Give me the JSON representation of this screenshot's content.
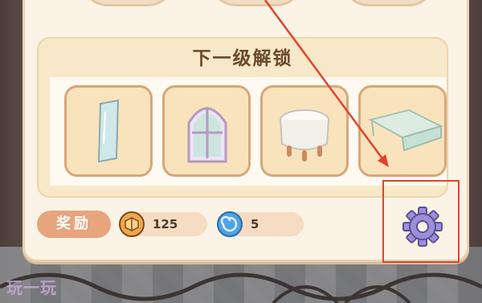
{
  "panel": {
    "unlock_title": "下一级解锁",
    "items": [
      {
        "name": "mirror-item",
        "icon": "mirror-icon"
      },
      {
        "name": "arched-window-item",
        "icon": "arched-window-icon"
      },
      {
        "name": "round-table-item",
        "icon": "round-table-icon"
      },
      {
        "name": "glass-table-item",
        "icon": "glass-table-icon"
      }
    ]
  },
  "reward": {
    "label": "奖励",
    "coin": {
      "icon": "cookie-coin-icon",
      "value": "125"
    },
    "swirl": {
      "icon": "blue-swirl-icon",
      "value": "5"
    }
  },
  "settings": {
    "icon": "gear-icon"
  },
  "annotation": {
    "color": "#e3422e"
  },
  "watermark": "玩一玩",
  "colors": {
    "panel": "#fbf4e6",
    "card": "#f7e8c9",
    "reward_label": "#e7a47d",
    "gear": "#9b8fd8"
  }
}
